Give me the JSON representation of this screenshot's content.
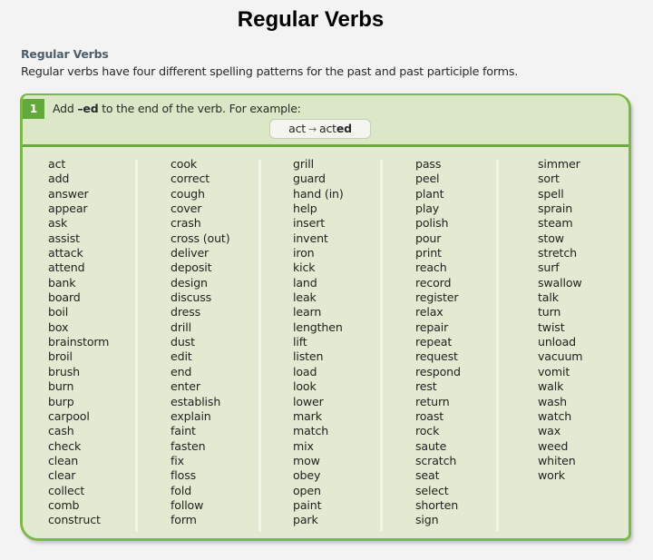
{
  "page_title": "Regular Verbs",
  "section": {
    "heading": "Regular Verbs",
    "intro": "Regular verbs have four different spelling patterns for the past and past participle forms."
  },
  "rule": {
    "number": "1",
    "text_before": "Add ",
    "suffix": "–ed",
    "text_after": " to the end of the verb.  For example:",
    "example": {
      "base": "act",
      "arrow": "→",
      "result_stem": "act",
      "result_suffix": "ed"
    }
  },
  "columns": [
    [
      "act",
      "add",
      "answer",
      "appear",
      "ask",
      "assist",
      "attack",
      "attend",
      "bank",
      "board",
      "boil",
      "box",
      "brainstorm",
      "broil",
      "brush",
      "burn",
      "burp",
      "carpool",
      "cash",
      "check",
      "clean",
      "clear",
      "collect",
      "comb",
      "construct"
    ],
    [
      "cook",
      "correct",
      "cough",
      "cover",
      "crash",
      "cross (out)",
      "deliver",
      "deposit",
      "design",
      "discuss",
      "dress",
      "drill",
      "dust",
      "edit",
      "end",
      "enter",
      "establish",
      "explain",
      "faint",
      "fasten",
      "fix",
      "floss",
      "fold",
      "follow",
      "form"
    ],
    [
      "grill",
      "guard",
      "hand (in)",
      "help",
      "insert",
      "invent",
      "iron",
      "kick",
      "land",
      "leak",
      "learn",
      "lengthen",
      "lift",
      "listen",
      "load",
      "look",
      "lower",
      "mark",
      "match",
      "mix",
      "mow",
      "obey",
      "open",
      "paint",
      "park"
    ],
    [
      "pass",
      "peel",
      "plant",
      "play",
      "polish",
      "pour",
      "print",
      "reach",
      "record",
      "register",
      "relax",
      "repair",
      "repeat",
      "request",
      "respond",
      "rest",
      "return",
      "roast",
      "rock",
      "saute",
      "scratch",
      "seat",
      "select",
      "shorten",
      "sign"
    ],
    [
      "simmer",
      "sort",
      "spell",
      "sprain",
      "steam",
      "stow",
      "stretch",
      "surf",
      "swallow",
      "talk",
      "turn",
      "twist",
      "unload",
      "vacuum",
      "vomit",
      "walk",
      "wash",
      "watch",
      "wax",
      "weed",
      "whiten",
      "work"
    ]
  ],
  "colors": {
    "panel_border": "#7ab848",
    "panel_background": "#e3ecd2",
    "badge": "#63a83a",
    "heading": "#4d5e6b"
  }
}
